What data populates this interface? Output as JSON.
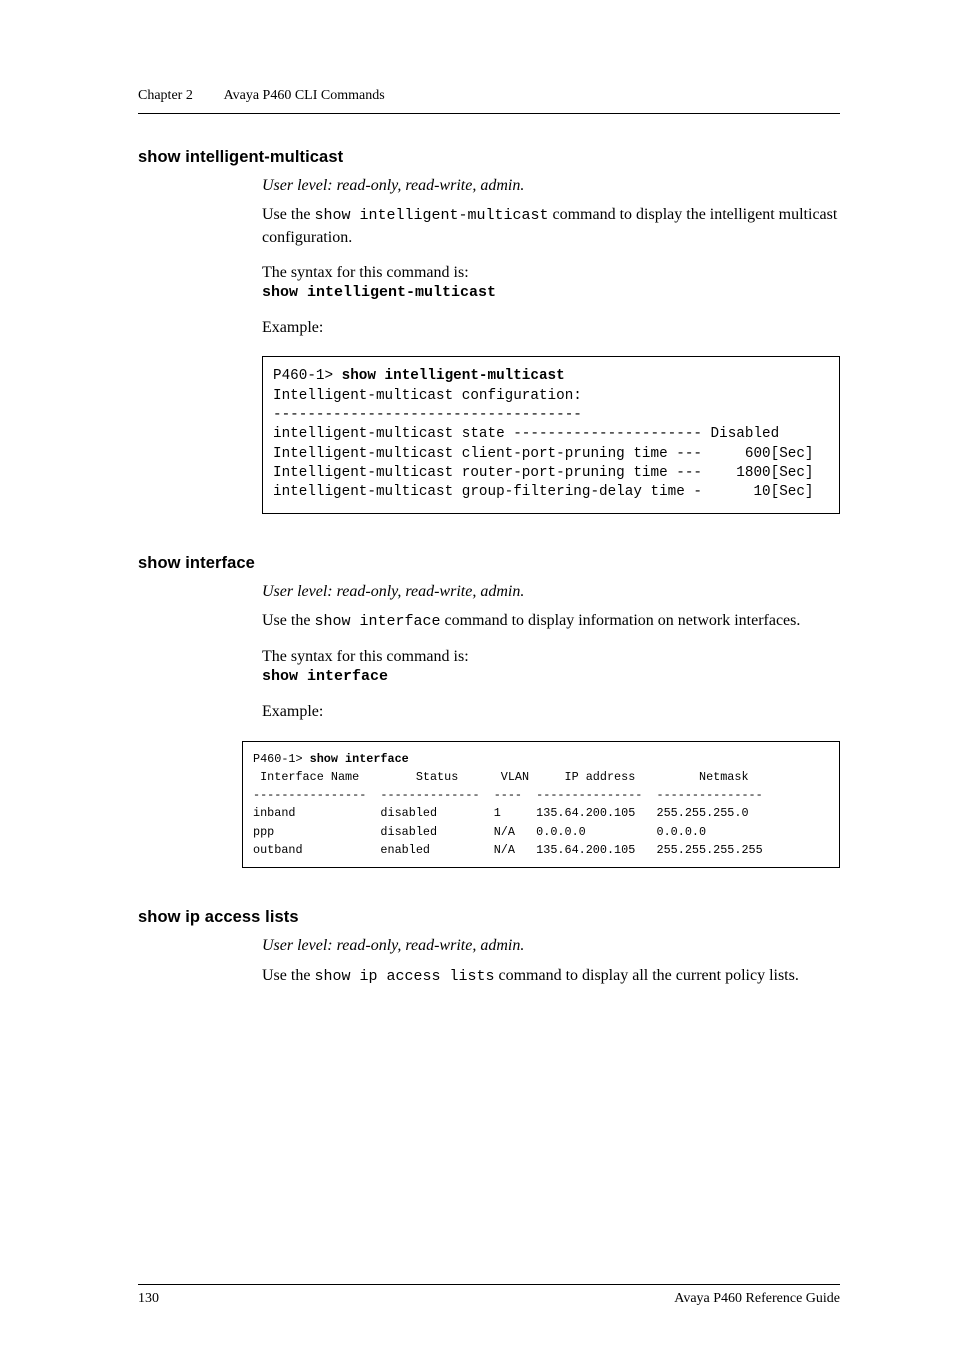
{
  "running_head": {
    "chapter": "Chapter 2",
    "title": "Avaya P460 CLI Commands"
  },
  "footer": {
    "left": "130",
    "right": "Avaya P460 Reference Guide"
  },
  "sec1": {
    "heading": "show intelligent-multicast",
    "userlevel": "User level: read-only, read-write, admin.",
    "desc_pre": "Use the ",
    "cmd_inline": "show intelligent-multicast",
    "desc_post": " command to display the intelligent multicast configuration.",
    "syntax_label": "The syntax for this command is:",
    "syntax_cmd": "show intelligent-multicast",
    "example_label": "Example:",
    "code_prompt": "P460-1> ",
    "code_cmd": "show intelligent-multicast",
    "code_rest": "Intelligent-multicast configuration:\n------------------------------------\nintelligent-multicast state ---------------------- Disabled\nIntelligent-multicast client-port-pruning time ---     600[Sec]\nIntelligent-multicast router-port-pruning time ---    1800[Sec]\nintelligent-multicast group-filtering-delay time -      10[Sec]"
  },
  "sec2": {
    "heading": "show interface",
    "userlevel": "User level: read-only, read-write, admin.",
    "desc_pre": "Use the ",
    "cmd_inline": "show interface",
    "desc_post": " command to display information on network interfaces.",
    "syntax_label": "The syntax for this command is:",
    "syntax_cmd": "show interface",
    "example_label": "Example:",
    "code_prompt": "P460-1> ",
    "code_cmd": "show interface",
    "code_rest": " Interface Name        Status      VLAN     IP address         Netmask\n----------------  --------------  ----  ---------------  ---------------\ninband            disabled        1     135.64.200.105   255.255.255.0\nppp               disabled        N/A   0.0.0.0          0.0.0.0\noutband           enabled         N/A   135.64.200.105   255.255.255.255"
  },
  "sec3": {
    "heading": "show ip access lists",
    "userlevel": "User level: read-only, read-write, admin.",
    "desc_pre": "Use the ",
    "cmd_inline": "show ip access lists",
    "desc_post": " command to display all the current policy lists."
  }
}
